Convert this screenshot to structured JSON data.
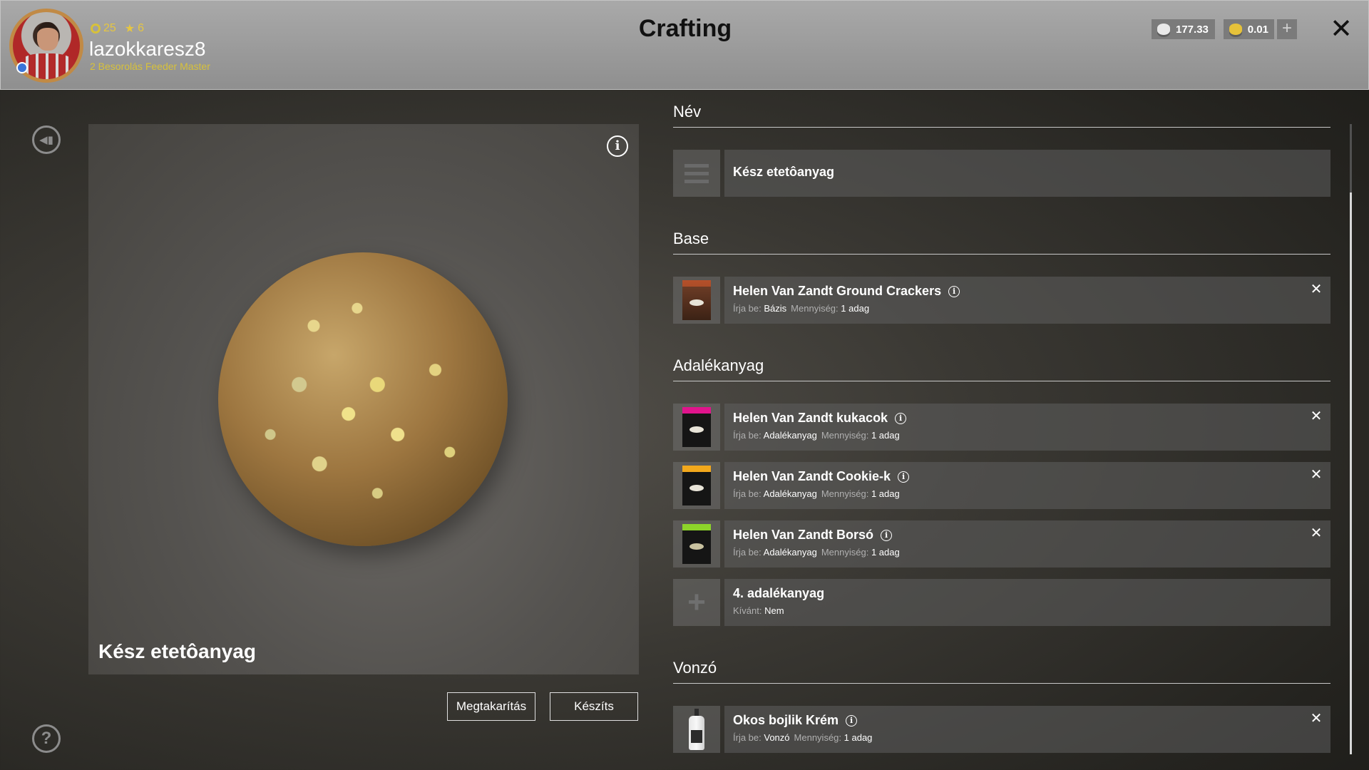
{
  "header": {
    "title": "Crafting",
    "player": {
      "name": "lazokkaresz8",
      "level": "25",
      "stars": "6",
      "rank": "2 Besorolás Feeder Master"
    },
    "currency": {
      "silver": "177.33",
      "gold": "0.01"
    },
    "add_label": "+",
    "close_label": "✕"
  },
  "preview": {
    "name": "Kész etetôanyag",
    "info_label": "i"
  },
  "buttons": {
    "save": "Megtakarítás",
    "craft": "Készíts"
  },
  "sections": {
    "name": {
      "title": "Név",
      "value": "Kész etetôanyag"
    },
    "base": {
      "title": "Base",
      "items": [
        {
          "name": "Helen Van Zandt Ground Crackers",
          "type_label": "Írja be:",
          "type": "Bázis",
          "qty_label": "Mennyiség:",
          "qty": "1 adag"
        }
      ]
    },
    "additive": {
      "title": "Adalékanyag",
      "items": [
        {
          "name": "Helen Van Zandt kukacok",
          "type_label": "Írja be:",
          "type": "Adalékanyag",
          "qty_label": "Mennyiség:",
          "qty": "1 adag",
          "accent": "#e0148c"
        },
        {
          "name": "Helen Van Zandt Cookie-k",
          "type_label": "Írja be:",
          "type": "Adalékanyag",
          "qty_label": "Mennyiség:",
          "qty": "1 adag",
          "accent": "#f2a81c"
        },
        {
          "name": "Helen Van Zandt Borsó",
          "type_label": "Írja be:",
          "type": "Adalékanyag",
          "qty_label": "Mennyiség:",
          "qty": "1 adag",
          "accent": "#8dd42a"
        }
      ],
      "empty_slot": {
        "name": "4. adalékanyag",
        "req_label": "Kívánt:",
        "req_value": "Nem"
      }
    },
    "attractor": {
      "title": "Vonzó",
      "items": [
        {
          "name": "Okos bojlik Krém",
          "type_label": "Írja be:",
          "type": "Vonzó",
          "qty_label": "Mennyiség:",
          "qty": "1 adag"
        }
      ]
    }
  },
  "colors": {
    "header_bg": "#9c9c9c",
    "accent_gold": "#e6c641",
    "panel_bg": "#5f5f5f"
  },
  "remove_label": "✕"
}
